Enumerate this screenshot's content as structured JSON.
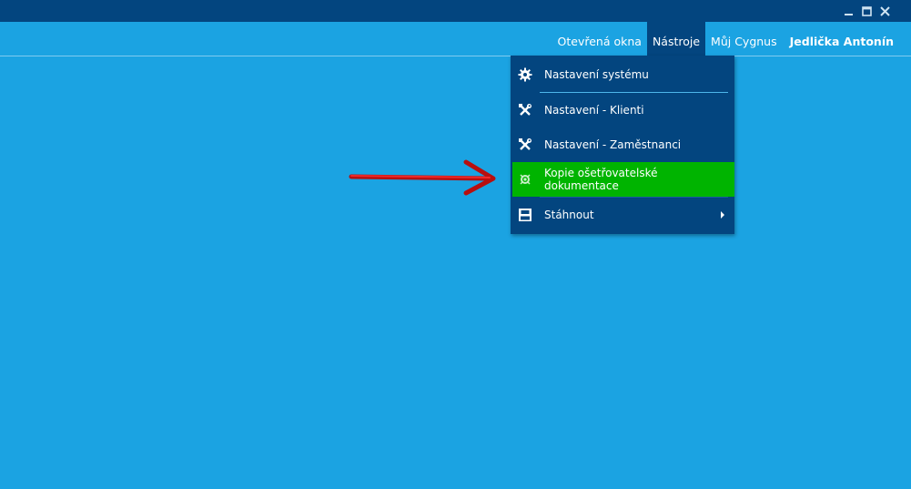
{
  "window_controls": [
    "minimize-icon",
    "maximize-icon",
    "close-icon"
  ],
  "nav": {
    "items": [
      {
        "label": "Otevřená okna"
      },
      {
        "label": "Nástroje"
      },
      {
        "label": "Můj Cygnus"
      },
      {
        "label": "Jedlička Antonín"
      }
    ],
    "active_index": 1
  },
  "tools_menu": {
    "items": [
      {
        "label": "Nastavení systému",
        "icon": "gear-icon"
      },
      {
        "label": "Nastavení - Klienti",
        "icon": "wrench-icon"
      },
      {
        "label": "Nastavení - Zaměstnanci",
        "icon": "wrench-icon"
      },
      {
        "label": "Kopie ošetřovatelské dokumentace",
        "icon": "archive-icon",
        "highlighted": true
      },
      {
        "label": "Stáhnout",
        "icon": "floppy-disk-icon",
        "has_submenu": true
      }
    ]
  },
  "colors": {
    "background": "#1ba3e2",
    "titlebar": "#03457f",
    "menu": "#03457f",
    "highlight": "#00b400",
    "annotation_arrow": "#e01010"
  }
}
